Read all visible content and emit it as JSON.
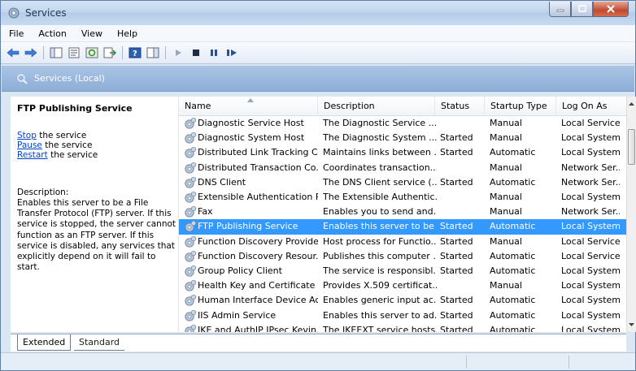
{
  "window": {
    "title": "Services"
  },
  "menu": [
    "File",
    "Action",
    "View",
    "Help"
  ],
  "scope": {
    "label": "Services (Local)"
  },
  "details": {
    "service_title": "FTP Publishing Service",
    "actions": [
      {
        "link": "Stop",
        "suffix": " the service"
      },
      {
        "link": "Pause",
        "suffix": " the service"
      },
      {
        "link": "Restart",
        "suffix": " the service"
      }
    ],
    "description_label": "Description:",
    "description_text": "Enables this server to be a File Transfer Protocol (FTP) server. If this service is stopped, the server cannot function as an FTP server. If this service is disabled, any services that explicitly depend on it will fail to start."
  },
  "list": {
    "columns": [
      "Name",
      "Description",
      "Status",
      "Startup Type",
      "Log On As"
    ],
    "rows": [
      {
        "name": "Diagnostic Service Host",
        "description": "The Diagnostic Service ...",
        "status": "",
        "startup": "Manual",
        "logon": "Local Service"
      },
      {
        "name": "Diagnostic System Host",
        "description": "The Diagnostic System ...",
        "status": "Started",
        "startup": "Manual",
        "logon": "Local System"
      },
      {
        "name": "Distributed Link Tracking C...",
        "description": "Maintains links between ...",
        "status": "Started",
        "startup": "Automatic",
        "logon": "Local System"
      },
      {
        "name": "Distributed Transaction Co...",
        "description": "Coordinates transaction...",
        "status": "",
        "startup": "Manual",
        "logon": "Network Ser..."
      },
      {
        "name": "DNS Client",
        "description": "The DNS Client service (...",
        "status": "Started",
        "startup": "Automatic",
        "logon": "Network Ser..."
      },
      {
        "name": "Extensible Authentication P...",
        "description": "The Extensible Authentic...",
        "status": "",
        "startup": "Manual",
        "logon": "Local System"
      },
      {
        "name": "Fax",
        "description": "Enables you to send and...",
        "status": "",
        "startup": "Manual",
        "logon": "Network Ser..."
      },
      {
        "name": "FTP Publishing Service",
        "description": "Enables this server to be ...",
        "status": "Started",
        "startup": "Automatic",
        "logon": "Local System",
        "selected": true
      },
      {
        "name": "Function Discovery Provide...",
        "description": "Host process for Functio...",
        "status": "Started",
        "startup": "Manual",
        "logon": "Local Service"
      },
      {
        "name": "Function Discovery Resour...",
        "description": "Publishes this computer ...",
        "status": "Started",
        "startup": "Automatic",
        "logon": "Local Service"
      },
      {
        "name": "Group Policy Client",
        "description": "The service is responsibl...",
        "status": "Started",
        "startup": "Automatic",
        "logon": "Local System"
      },
      {
        "name": "Health Key and Certificate ...",
        "description": "Provides X.509 certificat...",
        "status": "",
        "startup": "Manual",
        "logon": "Local System"
      },
      {
        "name": "Human Interface Device Ac...",
        "description": "Enables generic input ac...",
        "status": "Started",
        "startup": "Automatic",
        "logon": "Local System"
      },
      {
        "name": "IIS Admin Service",
        "description": "Enables this server to ad...",
        "status": "Started",
        "startup": "Automatic",
        "logon": "Local System"
      },
      {
        "name": "IKE and AuthIP IPsec Kevin...",
        "description": "The IKEEXT service hosts...",
        "status": "Started",
        "startup": "Automatic",
        "logon": "Local System"
      }
    ]
  },
  "tabs": [
    "Extended",
    "Standard"
  ],
  "colors": {
    "selection": "#3399ff",
    "link": "#0044cc",
    "scope_bar": "#9bb8dd"
  }
}
